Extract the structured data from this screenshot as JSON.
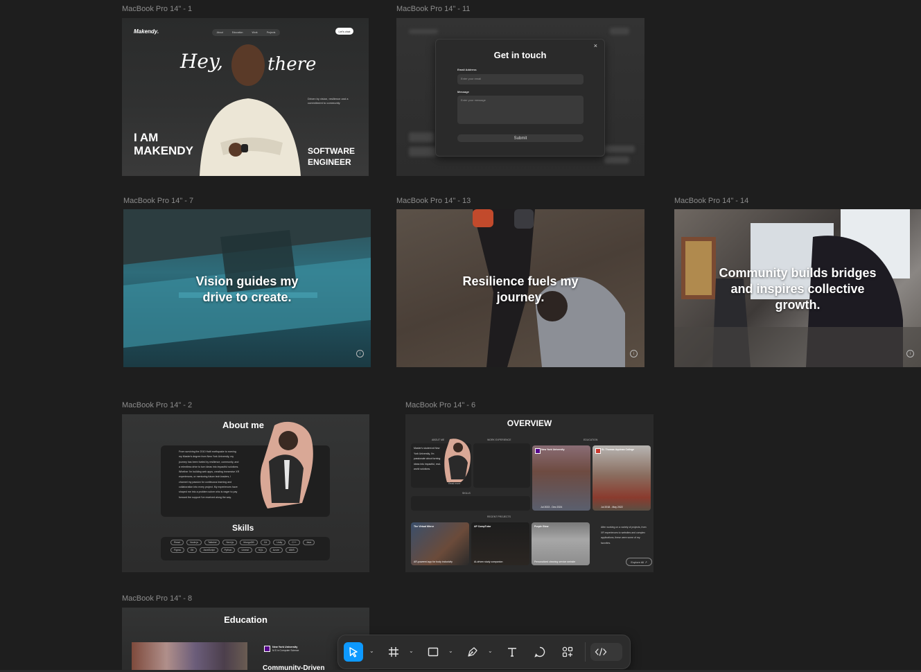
{
  "frames": {
    "f1": {
      "label": "MacBook Pro 14\" - 1",
      "brand": "Makendy.",
      "nav": [
        "About",
        "Education",
        "Work",
        "Projects"
      ],
      "cta": "Let's chat",
      "hey": "Hey,",
      "there": "there",
      "blurb": "Driven by vision, resilience and a commitment to community",
      "iam_line1": "I AM",
      "iam_line2": "MAKENDY",
      "role_line1": "SOFTWARE",
      "role_line2": "ENGINEER"
    },
    "f11": {
      "label": "MacBook Pro 14\" - 11",
      "modal_title": "Get in touch",
      "close": "×",
      "email_label": "Email Address",
      "email_placeholder": "Enter your email",
      "message_label": "Message",
      "message_placeholder": "Enter your message",
      "submit": "Submit"
    },
    "f7": {
      "label": "MacBook Pro 14\" - 7",
      "quote_line1": "Vision guides my",
      "quote_line2": "drive to create."
    },
    "f13": {
      "label": "MacBook Pro 14\" - 13",
      "quote_line1": "Resilience fuels my",
      "quote_line2": "journey."
    },
    "f14": {
      "label": "MacBook Pro 14\" - 14",
      "quote_line1": "Community builds bridges",
      "quote_line2": "and inspires collective",
      "quote_line3": "growth."
    },
    "f2": {
      "label": "MacBook Pro 14\" - 2",
      "about_title": "About me",
      "about_text": "From surviving the 2010 Haiti earthquake to earning my Master's degree from New York University, my journey has been fueled by resilience, community, and a relentless drive to turn ideas into impactful solutions. Whether I'm building web apps, creating immersive XR experiences, or mentoring future tech leaders, I channel my passion for continuous learning and collaboration into every project. My experiences have shaped me into a problem solver who is eager to pay forward the support I've received along the way.",
      "skills_title": "Skills",
      "skills": [
        "React",
        "Node.js",
        "Tailwind",
        "Next.js",
        "MongoDB",
        "C#",
        "Unity",
        "C++",
        "Java",
        "Figma",
        "Git",
        "JavaScript",
        "Python",
        "Unreal",
        "SQL",
        "Azure",
        "AWS"
      ]
    },
    "f6": {
      "label": "MacBook Pro 14\" - 6",
      "title": "OVERVIEW",
      "about_me": "ABOUT ME",
      "work_experience": "WORK EXPERIENCE",
      "education": "EDUCATION",
      "skills": "SKILLS",
      "recent_projects": "RECENT PROJECTS",
      "about_text": "Master's student at New York University, I'm passionate about turning ideas into impactful, real-world solutions.",
      "read_more": "Read more",
      "nyu_title": "New York University",
      "nyu_date": "Jul 2023 - Dec 2024",
      "stthomas_title": "St. Thomas Aquinas College",
      "stthomas_date": "Jul 2018 - May 2022",
      "projects": [
        {
          "title": "The Virtual Mirror",
          "caption": "AR-powered app for body inclusivity"
        },
        {
          "title": "AP CompTutor",
          "caption": "AI-driven study companion"
        },
        {
          "title": "Purple Glow",
          "caption": "Personalized cleaning service website"
        }
      ],
      "projects_blurb": "After working on a variety of projects, from XR experiences to websites and complex applications, these were some of my favorites.",
      "explore": "Explore All ↗"
    },
    "f8": {
      "label": "MacBook Pro 14\" - 8",
      "title": "Education",
      "nyu_name": "New York University",
      "nyu_sub": "M.S in Computer Science",
      "cd": "Community-Driven"
    }
  },
  "toolbar": {
    "tools": [
      "move-tool",
      "frame-tool",
      "shape-tool",
      "pen-tool",
      "text-tool",
      "comment-tool",
      "actions-tool",
      "dev-mode-toggle"
    ],
    "active": "move-tool",
    "accent": "#0d99ff"
  }
}
